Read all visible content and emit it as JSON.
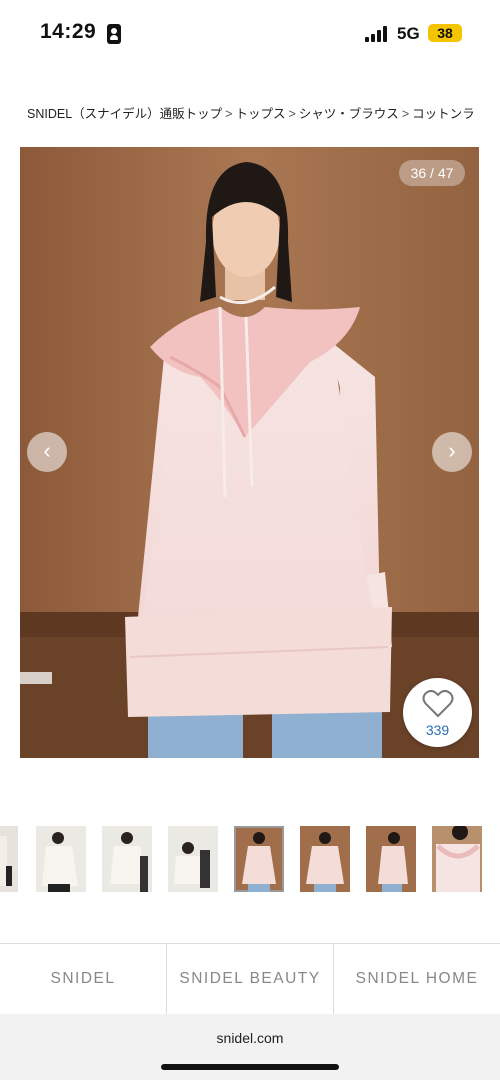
{
  "status_bar": {
    "time": "14:29",
    "network": "5G",
    "battery": "38",
    "battery_color": "#f5c400"
  },
  "breadcrumb": {
    "items": [
      "SNIDEL（スナイデル）通販トップ",
      "トップス",
      "シャツ・ブラウス",
      "コットンライクフリルブラウス"
    ],
    "separator": ">"
  },
  "gallery": {
    "counter": "36 / 47",
    "current": 36,
    "total": 47,
    "prev_icon": "chevron-left-icon",
    "next_icon": "chevron-right-icon",
    "favorite_count": "339",
    "favorite_icon": "heart-outline-icon",
    "favorite_count_color": "#2a6db5"
  },
  "thumbnails": {
    "count": 8,
    "active_index": 4
  },
  "footer_nav": {
    "items": [
      "SNIDEL",
      "SNIDEL BEAUTY",
      "SNIDEL HOME"
    ]
  },
  "browser": {
    "url": "snidel.com"
  }
}
